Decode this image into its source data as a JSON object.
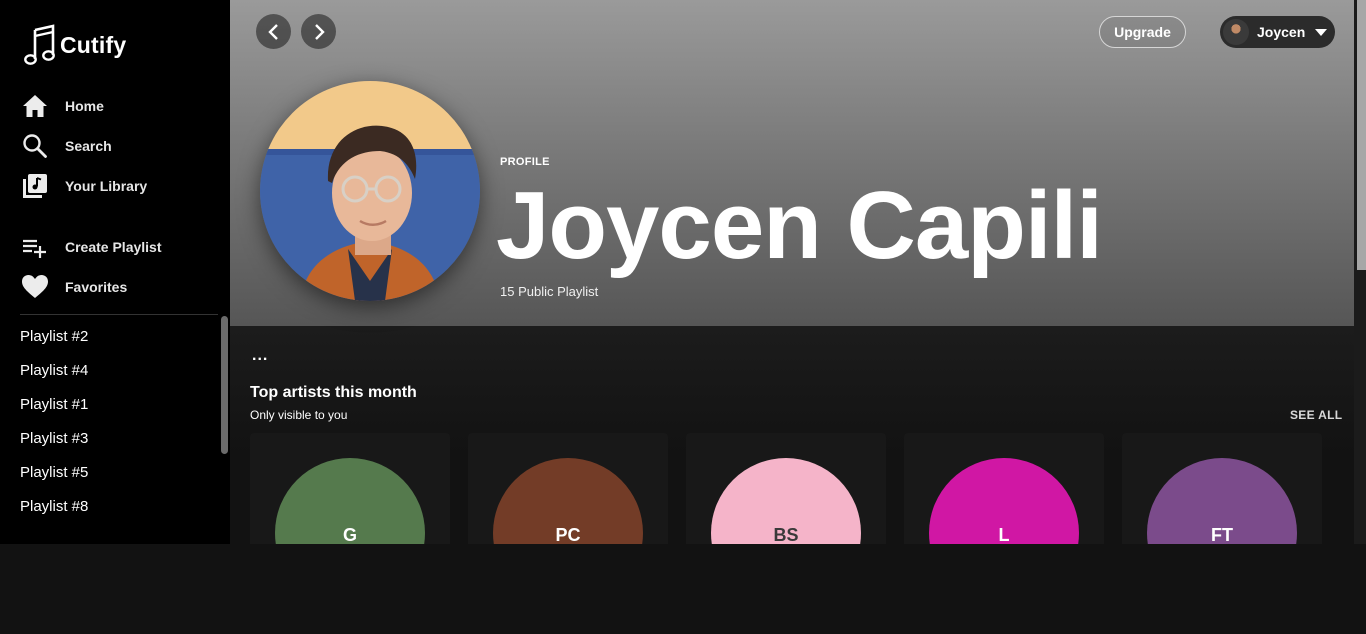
{
  "app": {
    "name": "Cutify"
  },
  "sidebar": {
    "nav": [
      {
        "label": "Home",
        "icon": "home-icon"
      },
      {
        "label": "Search",
        "icon": "search-icon"
      },
      {
        "label": "Your Library",
        "icon": "library-icon"
      },
      {
        "label": "Create Playlist",
        "icon": "create-playlist-icon"
      },
      {
        "label": "Favorites",
        "icon": "heart-icon"
      }
    ],
    "playlists": [
      "Playlist #2",
      "Playlist #4",
      "Playlist #1",
      "Playlist #3",
      "Playlist #5",
      "Playlist #8"
    ]
  },
  "topbar": {
    "upgrade_label": "Upgrade",
    "user_name": "Joycen"
  },
  "profile": {
    "label": "PROFILE",
    "name": "Joycen Capili",
    "subtitle": "15 Public Playlist"
  },
  "section": {
    "more": "...",
    "title": "Top artists this month",
    "subtitle": "Only visible to you",
    "see_all": "SEE ALL"
  },
  "artists": [
    {
      "initials": "G",
      "color": "#557a4d",
      "text_color": "#ffffff"
    },
    {
      "initials": "PC",
      "color": "#733c27",
      "text_color": "#ffffff"
    },
    {
      "initials": "BS",
      "color": "#f5b4c9",
      "text_color": "#3a3a3a"
    },
    {
      "initials": "L",
      "color": "#d017a4",
      "text_color": "#ffffff"
    },
    {
      "initials": "FT",
      "color": "#7b4b8b",
      "text_color": "#ffffff"
    }
  ]
}
